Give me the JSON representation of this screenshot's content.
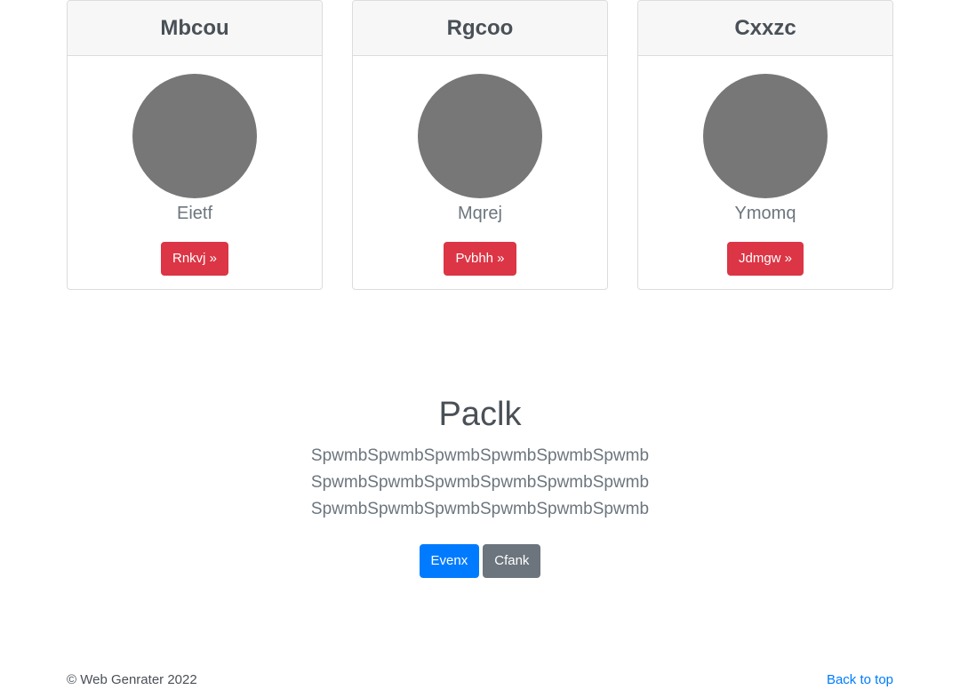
{
  "cards": [
    {
      "title": "Mbcou",
      "text": "Eietf",
      "button": "Rnkvj »"
    },
    {
      "title": "Rgcoo",
      "text": "Mqrej",
      "button": "Pvbhh »"
    },
    {
      "title": "Cxxzc",
      "text": "Ymomq",
      "button": "Jdmgw »"
    }
  ],
  "hero": {
    "title": "Paclk",
    "lines": [
      "SpwmbSpwmbSpwmbSpwmbSpwmbSpwmb",
      "SpwmbSpwmbSpwmbSpwmbSpwmbSpwmb",
      "SpwmbSpwmbSpwmbSpwmbSpwmbSpwmb"
    ],
    "primary_button": "Evenx",
    "secondary_button": "Cfank"
  },
  "footer": {
    "copyright": "© Web Genrater 2022",
    "back_to_top": "Back to top"
  },
  "colors": {
    "danger": "#dc3545",
    "primary": "#007bff",
    "secondary": "#6c757d",
    "avatar": "#777777"
  },
  "icons": {
    "avatar": "avatar-placeholder-circle"
  }
}
